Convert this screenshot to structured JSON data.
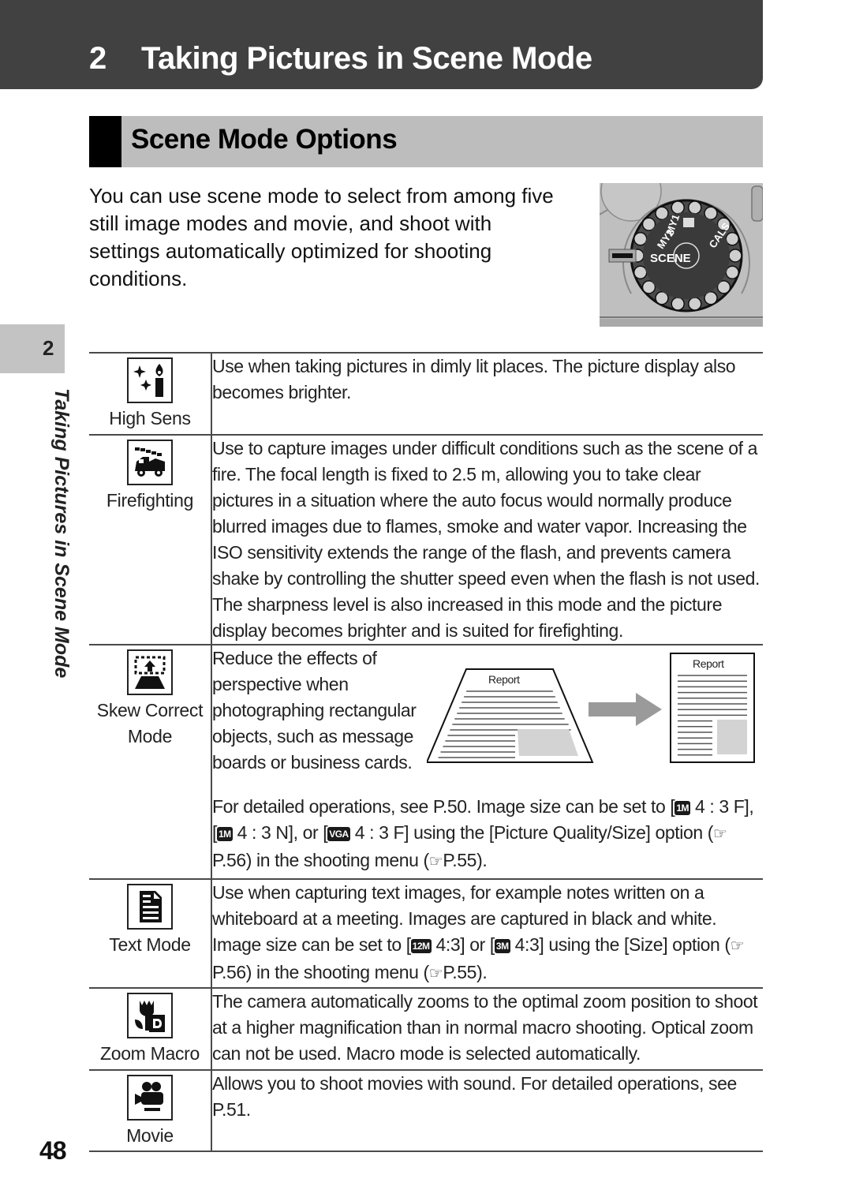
{
  "chapter": {
    "number": "2",
    "title": "Taking Pictures in Scene Mode"
  },
  "section": {
    "title": "Scene Mode Options"
  },
  "intro": "You can use scene mode to select from among five still image modes and movie, and shoot with settings automatically optimized for shooting conditions.",
  "dial": {
    "labels": [
      "SCENE",
      "MY2",
      "MY1",
      "CALS"
    ]
  },
  "side_tab": {
    "number": "2",
    "label": "Taking Pictures in Scene Mode"
  },
  "page_number": "48",
  "modes": [
    {
      "icon": "high-sens-icon",
      "label": "High Sens",
      "description": "Use when taking pictures in dimly lit places. The picture display also becomes brighter."
    },
    {
      "icon": "firefighting-icon",
      "label": "Firefighting",
      "description": "Use to capture images under difficult conditions such as the scene of a fire. The focal length is fixed to 2.5 m, allowing you to take clear pictures in a situation where the auto focus would normally produce blurred images due to flames, smoke and water vapor. Increasing the ISO sensitivity extends the range of the flash, and prevents camera shake by controlling the shutter speed even when the flash is not used. The sharpness level is also increased in this mode and the picture display becomes brighter and is suited for firefighting."
    },
    {
      "icon": "skew-correct-icon",
      "label": "Skew Correct Mode",
      "description": "Reduce the effects of perspective when photographing rectangular objects, such as message boards or business cards.",
      "figure": {
        "before_label": "Report",
        "after_label": "Report"
      },
      "details": {
        "part1": "For detailed operations, see P.50. Image size can be set to [",
        "badge1": "1M",
        "part2": " 4 : 3 F], [",
        "badge2": "1M",
        "part3": " 4 : 3 N], or [",
        "badge3": "VGA",
        "part4": " 4 : 3 F] using the [Picture Quality/Size] option (",
        "ref1": "P.56",
        "part5": ") in the shooting menu (",
        "ref2": "P.55",
        "part6": ")."
      }
    },
    {
      "icon": "text-mode-icon",
      "label": "Text Mode",
      "description": {
        "part1": "Use when capturing text images, for example notes written on a whiteboard at a meeting. Images are captured in black and white. Image size can be set to [",
        "badge1": "12M",
        "part2": " 4:3] or [",
        "badge2": "3M",
        "part3": " 4:3] using the [Size] option (",
        "ref1": "P.56",
        "part4": ") in the shooting menu (",
        "ref2": "P.55",
        "part5": ")."
      }
    },
    {
      "icon": "zoom-macro-icon",
      "label": "Zoom Macro",
      "description": "The camera automatically zooms to the optimal zoom position to shoot at a higher magnification than in normal macro shooting. Optical zoom can not be used. Macro mode is selected automatically."
    },
    {
      "icon": "movie-icon",
      "label": "Movie",
      "description": "Allows you to shoot movies with sound. For detailed operations, see P.51."
    }
  ]
}
